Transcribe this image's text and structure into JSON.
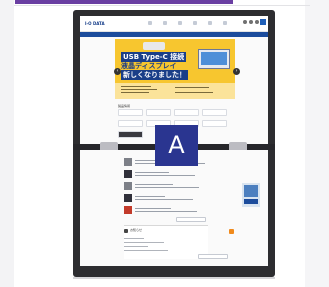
{
  "header": {
    "accent_bar_color": "#6a3fa2"
  },
  "device": {
    "brand_mark": "",
    "site_logo": "I-O DATA",
    "notice_text": "",
    "banner": {
      "line1": "USB Type-C 接続",
      "line2": "液晶ディスプレイ",
      "line3": "新しくなりました！"
    },
    "section_label": "製品情報",
    "info_title": "お知らせ",
    "colors": {
      "frame": "#2d2d30",
      "banner": "#f7c62f",
      "navy": "#1a3e88"
    }
  },
  "marker": {
    "label": "A",
    "color": "#2a3590"
  }
}
